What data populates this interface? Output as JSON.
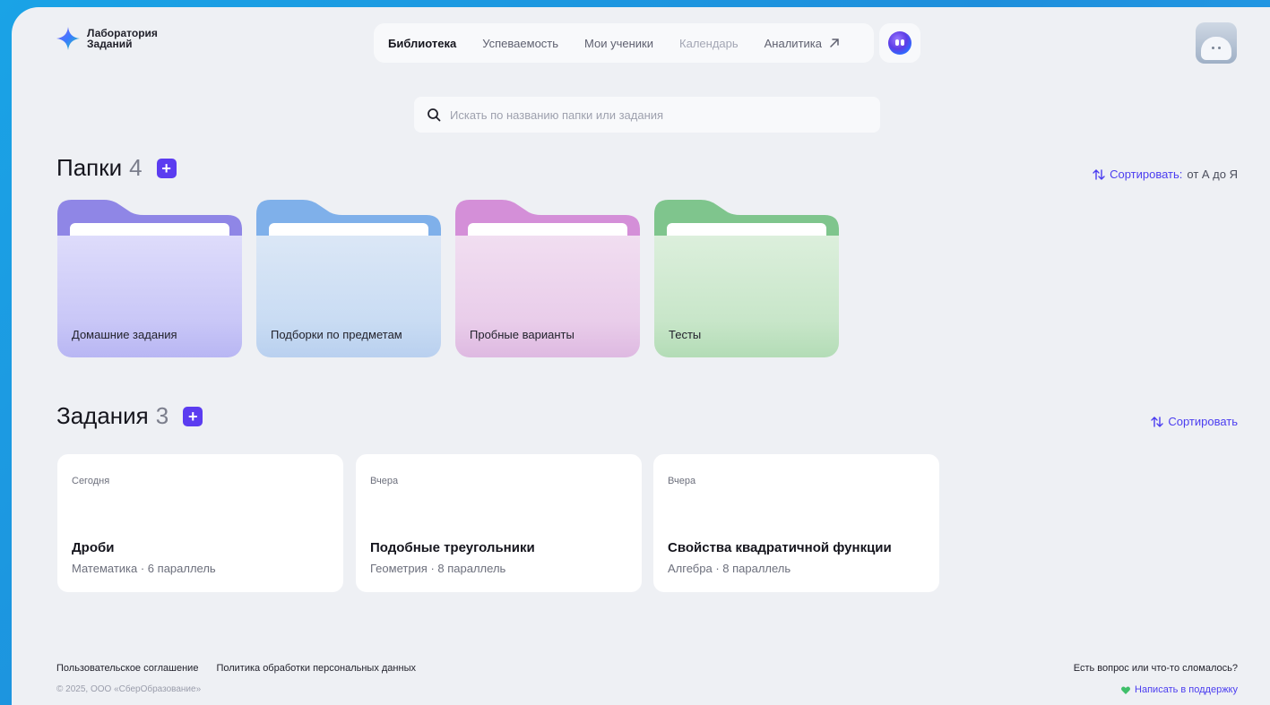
{
  "logo": {
    "line1": "Лаборатория",
    "line2": "Заданий"
  },
  "nav": {
    "items": [
      {
        "label": "Библиотека"
      },
      {
        "label": "Успеваемость"
      },
      {
        "label": "Мои ученики"
      },
      {
        "label": "Календарь"
      },
      {
        "label": "Аналитика"
      }
    ],
    "external_icon": "arrow-up-right-icon"
  },
  "search": {
    "placeholder": "Искать по названию папки или задания"
  },
  "folders_section": {
    "title": "Папки",
    "count": "4",
    "sort_label": "Сортировать:",
    "sort_value": "от А до Я",
    "items": [
      {
        "label": "Домашние задания",
        "color": "#b8b3f2"
      },
      {
        "label": "Подборки по предметам",
        "color": "#a9c8ef"
      },
      {
        "label": "Пробные варианты",
        "color": "#e1b8e8"
      },
      {
        "label": "Тесты",
        "color": "#b5dfbc"
      }
    ]
  },
  "tasks_section": {
    "title": "Задания",
    "count": "3",
    "sort_label": "Сортировать",
    "items": [
      {
        "date": "Сегодня",
        "name": "Дроби",
        "meta": "Математика · 6 параллель"
      },
      {
        "date": "Вчера",
        "name": "Подобные треугольники",
        "meta": "Геометрия · 8 параллель"
      },
      {
        "date": "Вчера",
        "name": "Свойства квадратичной функции",
        "meta": "Алгебра · 8 параллель"
      }
    ]
  },
  "footer": {
    "agreement": "Пользовательское соглашение",
    "privacy": "Политика обработки персональных данных",
    "copyright": "© 2025, ООО «СберОбразование»",
    "question": "Есть вопрос или что-то сломалось?",
    "support": "Написать в поддержку"
  }
}
